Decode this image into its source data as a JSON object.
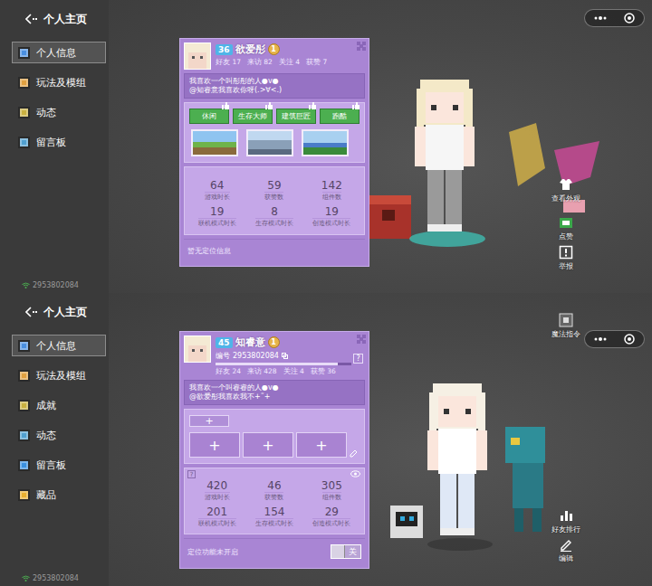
{
  "panels": [
    {
      "header": {
        "title": "个人主页"
      },
      "sidebar": {
        "items": [
          {
            "label": "个人信息",
            "selected": true
          },
          {
            "label": "玩法及模组",
            "selected": false
          },
          {
            "label": "动态",
            "selected": false
          },
          {
            "label": "留言板",
            "selected": false
          }
        ],
        "footer": "2953802084"
      },
      "profile": {
        "level": "36",
        "name": "欲爱彤",
        "badge": "1",
        "id": null,
        "xp": null,
        "help": null,
        "counts": [
          {
            "label": "好友",
            "value": "17"
          },
          {
            "label": "来访",
            "value": "82"
          },
          {
            "label": "关注",
            "value": "4"
          },
          {
            "label": "获赞",
            "value": "7"
          }
        ],
        "signature": [
          "我喜欢一个叫彤彤的人●v●",
          "@知睿意我喜欢你呀(.>∀<.)"
        ],
        "section": {
          "kind": "tags",
          "tags": [
            {
              "label": "休闲"
            },
            {
              "label": "生存大师"
            },
            {
              "label": "建筑巨匠"
            },
            {
              "label": "跑酷"
            }
          ],
          "thumbnails": [
            {
              "kind": "image"
            },
            {
              "kind": "image"
            },
            {
              "kind": "image"
            }
          ]
        },
        "stats_help": null,
        "stats_eye": false,
        "stats": [
          {
            "value": "64",
            "label": "游戏时长"
          },
          {
            "value": "59",
            "label": "获赞数"
          },
          {
            "value": "142",
            "label": "组件数"
          },
          {
            "value": "19",
            "label": "联机模式时长"
          },
          {
            "value": "8",
            "label": "生存模式时长"
          },
          {
            "value": "19",
            "label": "创造模式时长"
          }
        ],
        "location": {
          "text": "暂无定位信息",
          "toggle": null
        }
      },
      "actions": [
        {
          "kind": "appearance",
          "label": "查看外观"
        },
        {
          "kind": "like",
          "label": "点赞"
        },
        {
          "kind": "report",
          "label": "举报"
        }
      ]
    },
    {
      "header": {
        "title": "个人主页"
      },
      "sidebar": {
        "items": [
          {
            "label": "个人信息",
            "selected": true
          },
          {
            "label": "玩法及模组",
            "selected": false
          },
          {
            "label": "成就",
            "selected": false
          },
          {
            "label": "动态",
            "selected": false
          },
          {
            "label": "留言板",
            "selected": false
          },
          {
            "label": "藏品",
            "selected": false
          }
        ],
        "footer": "2953802084"
      },
      "profile": {
        "level": "45",
        "name": "知睿意",
        "badge": "1",
        "id": {
          "label": "编号",
          "value": "2953802084"
        },
        "xp": 0.9,
        "help": "?",
        "counts": [
          {
            "label": "好友",
            "value": "24"
          },
          {
            "label": "来访",
            "value": "428"
          },
          {
            "label": "关注",
            "value": "4"
          },
          {
            "label": "获赞",
            "value": "36"
          }
        ],
        "signature": [
          "我喜欢一个叫睿睿的人●v●",
          "@欲爱彤我喜欢我不+˜+"
        ],
        "section": {
          "kind": "editable",
          "add": "+",
          "slots": [
            "+",
            "+",
            "+"
          ]
        },
        "stats_help": "?",
        "stats_eye": true,
        "stats": [
          {
            "value": "420",
            "label": "游戏时长"
          },
          {
            "value": "46",
            "label": "获赞数"
          },
          {
            "value": "305",
            "label": "组件数"
          },
          {
            "value": "201",
            "label": "联机模式时长"
          },
          {
            "value": "154",
            "label": "生存模式时长"
          },
          {
            "value": "29",
            "label": "创造模式时长"
          }
        ],
        "location": {
          "text": "定位功能未开启",
          "toggle": {
            "label": "关",
            "on": false
          }
        }
      },
      "actions": [
        {
          "kind": "magic",
          "label": "魔法指令"
        },
        {
          "kind": "rank",
          "label": "好友排行"
        },
        {
          "kind": "edit",
          "label": "编辑"
        }
      ]
    }
  ]
}
